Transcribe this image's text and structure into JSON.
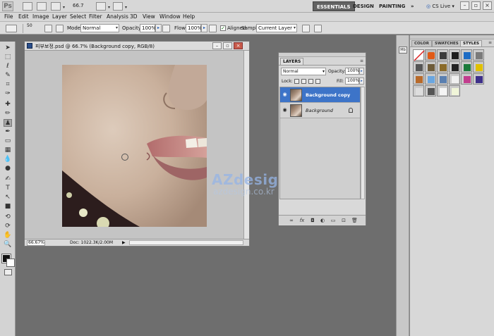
{
  "app": {
    "logo": "Ps",
    "zoom": "66.7",
    "workspaces": [
      "ESSENTIALS",
      "DESIGN",
      "PAINTING"
    ],
    "more": "»",
    "cs_live": "CS Live"
  },
  "menu": [
    "File",
    "Edit",
    "Image",
    "Layer",
    "Select",
    "Filter",
    "Analysis",
    "3D",
    "View",
    "Window",
    "Help"
  ],
  "options": {
    "brush_size": "50",
    "mode_label": "Mode:",
    "mode_value": "Normal",
    "opacity_label": "Opacity:",
    "opacity_value": "100%",
    "flow_label": "Flow:",
    "flow_value": "100%",
    "aligned_label": "Aligned",
    "sample_label": "Sample:",
    "sample_value": "Current Layer"
  },
  "document": {
    "title": "피부보정.psd @ 66.7% (Background copy, RGB/8)",
    "zoom_field": "66.67%",
    "doc_info": "Doc: 1022.3K/2.00M"
  },
  "layers_panel": {
    "tab": "LAYERS",
    "blend_mode": "Normal",
    "opacity_label": "Opacity:",
    "opacity_value": "100%",
    "lock_label": "Lock:",
    "fill_label": "Fill:",
    "fill_value": "100%",
    "layers": [
      {
        "name": "Background copy",
        "selected": true
      },
      {
        "name": "Background",
        "selected": false
      }
    ]
  },
  "right_dock": {
    "tabs": [
      "COLOR",
      "SWATCHES",
      "STYLES"
    ],
    "active_tab": "STYLES"
  },
  "watermark": {
    "main": "AZdesign",
    "sup": "TM",
    "sub": "azdesign.co.kr"
  },
  "colors": {
    "selection_blue": "#3d74c8",
    "workspace_gray": "#6e6e6e"
  }
}
